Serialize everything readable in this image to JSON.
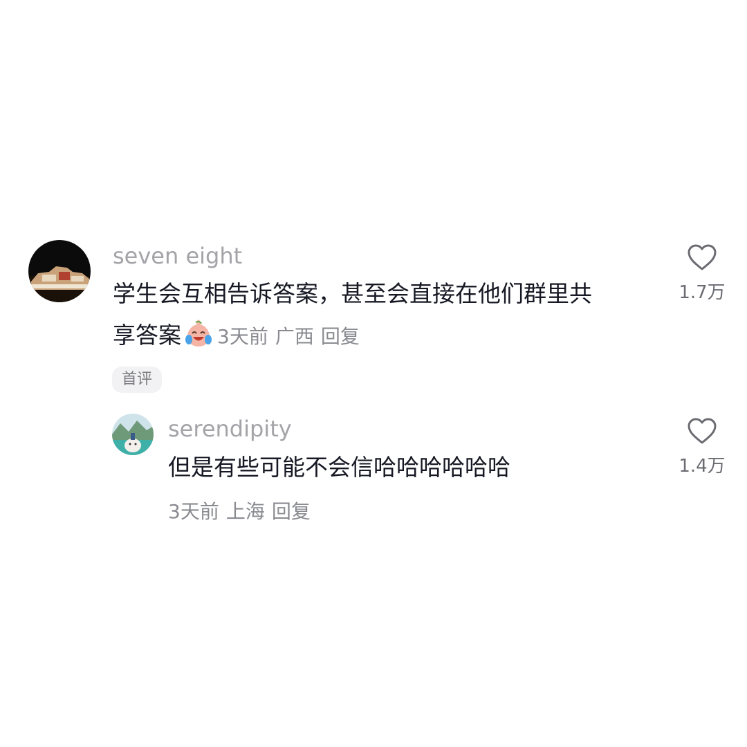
{
  "comments": [
    {
      "username": "seven eight",
      "text_line1": "学生会互相告诉答案，甚至会直接在他们群里共",
      "text_line2": "享答案",
      "emoji": "crying-laughing-emoji",
      "time": "3天前",
      "location": "广西",
      "reply_label": "回复",
      "likes": "1.7万",
      "badge": "首评"
    },
    {
      "username": "serendipity",
      "text": "但是有些可能不会信哈哈哈哈哈哈",
      "time": "3天前",
      "location": "上海",
      "reply_label": "回复",
      "likes": "1.4万"
    }
  ],
  "icons": {
    "like": "heart-outline-icon"
  },
  "colors": {
    "username": "#a3a3a8",
    "text": "#161823",
    "meta": "#8a8b91"
  }
}
